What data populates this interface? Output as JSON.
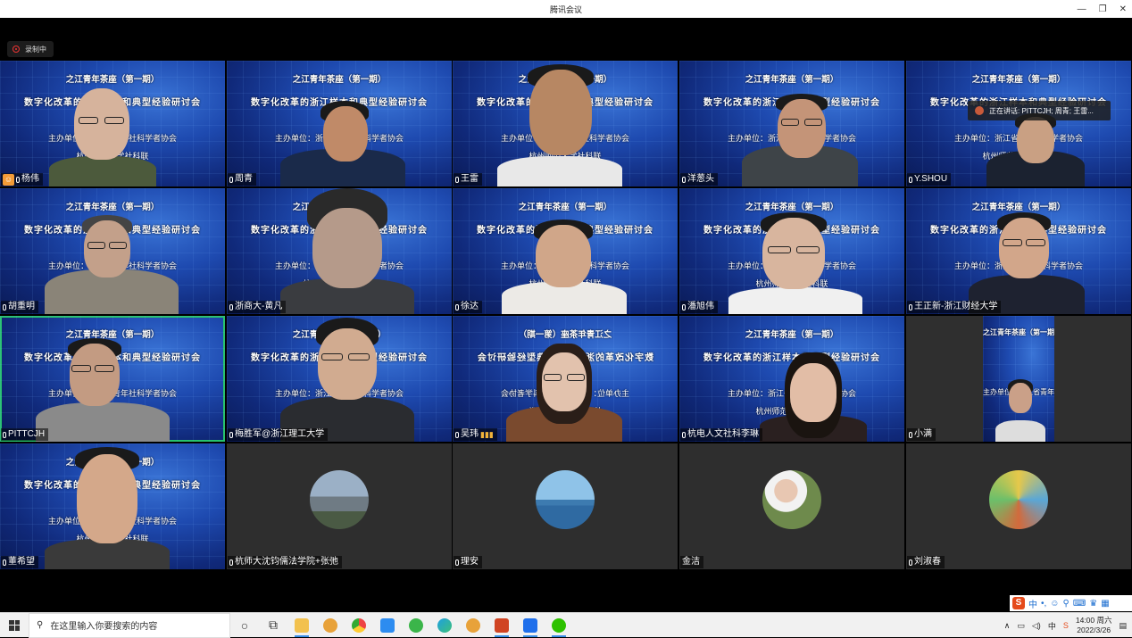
{
  "window": {
    "title": "腾讯会议",
    "controls": [
      "—",
      "❐",
      "✕"
    ]
  },
  "recording": {
    "label": "录制中"
  },
  "banner": {
    "line1": "之江青年茶座（第一期）",
    "line2": "数字化改革的浙江样本和典型经验研讨会",
    "line3": "主办单位：浙江省青年社科学者协会",
    "line4": "杭州师范大学社科联"
  },
  "speaking_tip": "正在讲话: PITTCJH; 周青; 王雷...",
  "participants": [
    {
      "name": "杨伟",
      "host": true
    },
    {
      "name": "周青"
    },
    {
      "name": "王雷"
    },
    {
      "name": "洋葱头"
    },
    {
      "name": "Y.SHOU"
    },
    {
      "name": "胡重明"
    },
    {
      "name": "浙商大-黄凡"
    },
    {
      "name": "徐达"
    },
    {
      "name": "潘旭伟"
    },
    {
      "name": "王正新-浙江财经大学"
    },
    {
      "name": "PITTCJH"
    },
    {
      "name": "梅胜军@浙江理工大学"
    },
    {
      "name": "吴玮"
    },
    {
      "name": "杭电人文社科李琳"
    },
    {
      "name": "小满"
    },
    {
      "name": "董希望"
    },
    {
      "name": "杭师大沈钧儒法学院+张弛"
    },
    {
      "name": "理安"
    },
    {
      "name": "金洁"
    },
    {
      "name": "刘淑春"
    }
  ],
  "taskbar": {
    "search_placeholder": "在这里输入你要搜索的内容",
    "time": "14:00 周六",
    "date": "2022/3/26",
    "ime": "中"
  },
  "colors": {
    "accent_active": "#27c26d",
    "host_badge": "#f29b37",
    "record": "#e33333"
  }
}
